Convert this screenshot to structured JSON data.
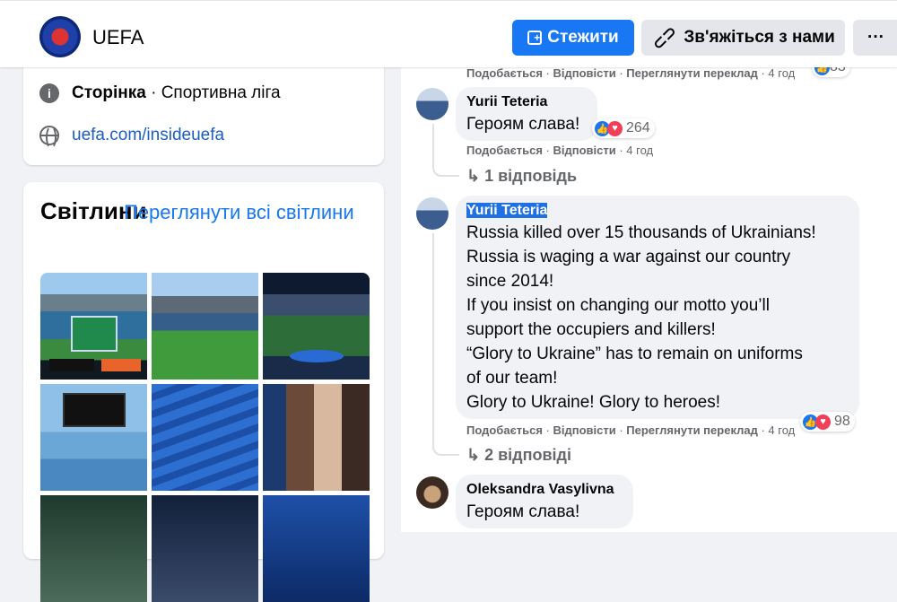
{
  "header": {
    "page_name": "UEFA",
    "follow_label": "Стежити",
    "contact_label": "Зв'яжіться з нами",
    "more_label": "···"
  },
  "intro": {
    "category_bold": "Сторінка",
    "category_rest": " · Спортивна ліга",
    "website": "uefa.com/insideuefa"
  },
  "photos": {
    "title": "Світлини",
    "see_all": "Переглянути всі світлини"
  },
  "comments": {
    "top_meta": {
      "like": "Подобається",
      "reply": "Відповісти",
      "translate": "Переглянути переклад",
      "time": "4 год"
    },
    "top_reactions": "83",
    "items": [
      {
        "author": "Yurii Teteria",
        "text": "Героям слава!",
        "reactions": "264",
        "meta": {
          "like": "Подобається",
          "reply": "Відповісти",
          "time": "4 год"
        },
        "replies": "1 відповідь"
      },
      {
        "author": "Yurii Teteria",
        "lines": [
          "Russia killed over 15 thousands of Ukrainians!",
          "Russia is waging a war against our country",
          "since 2014!",
          "If you insist on changing our motto you’ll",
          "support the occupiers and killers!",
          "“Glory to Ukraine” has to remain on uniforms",
          "of our team!",
          "Glory to Ukraine! Glory to heroes!"
        ],
        "reactions": "98",
        "meta": {
          "like": "Подобається",
          "reply": "Відповісти",
          "translate": "Переглянути переклад",
          "time": "4 год"
        },
        "replies": "2 відповіді"
      },
      {
        "author": "Oleksandra Vasylivna",
        "text": "Героям слава!"
      }
    ]
  },
  "colors": {
    "accent": "#1877f2",
    "bubble": "#f0f2f5",
    "muted": "#65676b"
  },
  "icons": {
    "follow": "follow-plus-icon",
    "contact": "link-icon",
    "info": "info-icon",
    "web": "globe-icon",
    "reply": "reply-arrow-icon",
    "like": "like-icon",
    "love": "love-icon"
  }
}
